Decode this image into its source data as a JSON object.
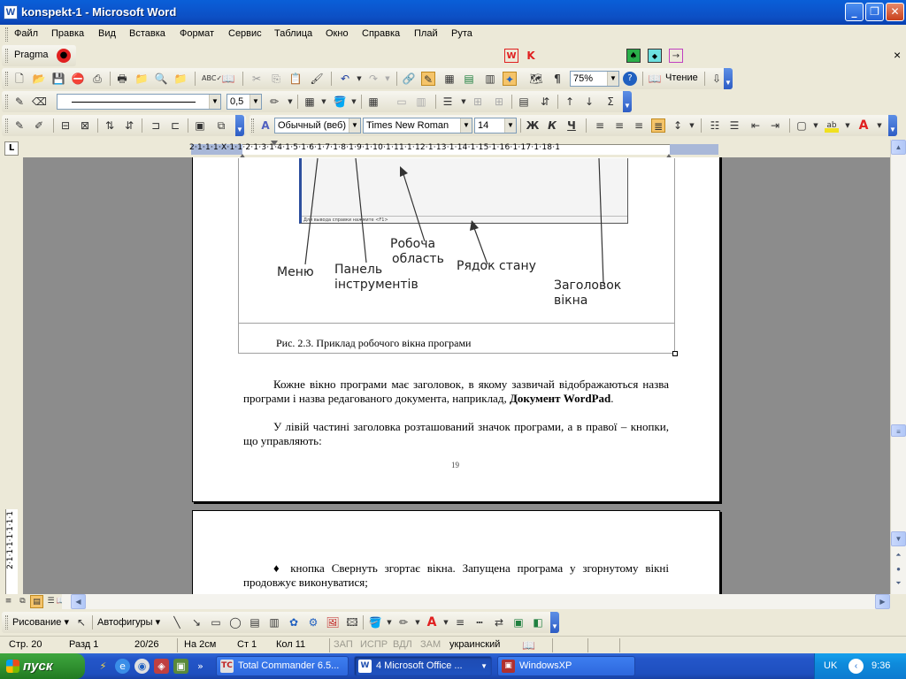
{
  "window": {
    "title": "konspekt-1 - Microsoft Word",
    "app_icon": "word-icon",
    "minimize": "_",
    "maximize": "❐",
    "close": "✕"
  },
  "menu": {
    "items": [
      "Файл",
      "Правка",
      "Вид",
      "Вставка",
      "Формат",
      "Сервис",
      "Таблица",
      "Окно",
      "Справка",
      "Плай",
      "Рута"
    ],
    "close_doc": "×"
  },
  "pragma_bar": {
    "label": "Pragma",
    "close": "×"
  },
  "standard_toolbar": {
    "zoom": "75%",
    "read_button": "Чтение"
  },
  "drawing_props_bar": {
    "line_weight": "0,5"
  },
  "formatting_toolbar": {
    "style": "Обычный (веб)",
    "font": "Times New Roman",
    "size": "14",
    "bold": "Ж",
    "italic": "К",
    "underline": "Ч"
  },
  "ruler": {
    "tab_selector": "L",
    "numbers": "2·1·1·1·X·1·1·2·1·3·1·4·1·5·1·6·1·7·1·8·1·9·1·10·1·11·1·12·1·13·1·14·1·15·1·16·1·17·1·18·1",
    "vertical_numbers": "2·1·1·1·1·1·1·1"
  },
  "document": {
    "figure": {
      "status_text": "Для вывода справки нажмите <F1>",
      "labels": {
        "menu": "Меню",
        "toolbar_line1": "Панель",
        "toolbar_line2": "інструментів",
        "workarea_line1": "Робоча",
        "workarea_line2": "область",
        "statusbar": "Рядок стану",
        "title_line1": "Заголовок",
        "title_line2": "вікна"
      },
      "caption": "Рис. 2.3. Приклад робочого вікна програми"
    },
    "para1_start": "Кожне вікно програми має заголовок, в якому зазвичай відображаються назва програми і назва редагованого документа, наприклад, ",
    "para1_bold": "Документ WordPad",
    "para1_end": ".",
    "para2": "У лівій частині заголовка розташований значок програми, а в правої – кнопки, що управляють:",
    "page_number": "19",
    "page2_bullet": "♦",
    "page2_para": "кнопка  Свернуть згортає вікна. Запущена програма у згорнутому вікні продовжує виконуватися;"
  },
  "drawing_toolbar": {
    "draw_menu": "Рисование",
    "autoshapes_menu": "Автофигуры"
  },
  "status_bar": {
    "page": "Стр.  20",
    "section": "Разд  1",
    "pages": "20/26",
    "at": "На 2см",
    "line": "Ст  1",
    "column": "Кол  11",
    "rec": "ЗАП",
    "trk": "ИСПР",
    "ext": "ВДЛ",
    "ovr": "ЗАМ",
    "language": "украинский"
  },
  "taskbar": {
    "start": "пуск",
    "tasks": [
      {
        "label": "Total Commander 6.5...",
        "icon": "TC"
      },
      {
        "label": "4 Microsoft Office ...",
        "icon": "W"
      },
      {
        "label": "WindowsXP",
        "icon": "▣"
      }
    ],
    "language": "UK",
    "clock": "9:36"
  },
  "colors": {
    "titlebar": "#0b58d0",
    "taskbar": "#2456c9",
    "start": "#2d8d2d",
    "accent_red": "#e02020"
  }
}
